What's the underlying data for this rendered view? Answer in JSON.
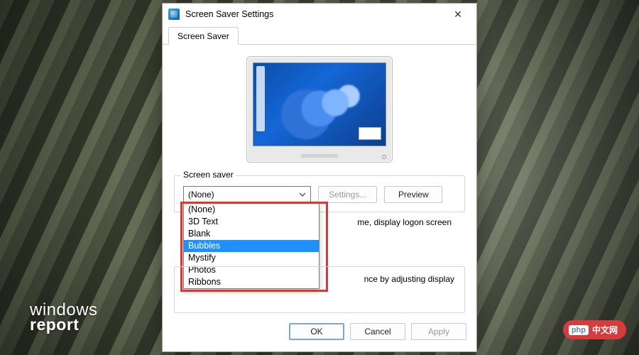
{
  "dialog": {
    "title": "Screen Saver Settings",
    "close_symbol": "✕",
    "tab_label": "Screen Saver"
  },
  "group": {
    "legend": "Screen saver",
    "combo_selected": "(None)",
    "settings_btn": "Settings...",
    "preview_btn": "Preview",
    "options": [
      "(None)",
      "3D Text",
      "Blank",
      "Bubbles",
      "Mystify",
      "Photos",
      "Ribbons"
    ],
    "highlighted_option": "Bubbles",
    "wait_fragment": "me, display logon screen"
  },
  "group2": {
    "fragment": "nce by adjusting display",
    "link_fragment": ""
  },
  "footer": {
    "ok": "OK",
    "cancel": "Cancel",
    "apply": "Apply"
  },
  "branding": {
    "logo_top": "windows",
    "logo_bottom": "report",
    "badge_prefix": "php",
    "badge_text": "中文网"
  }
}
